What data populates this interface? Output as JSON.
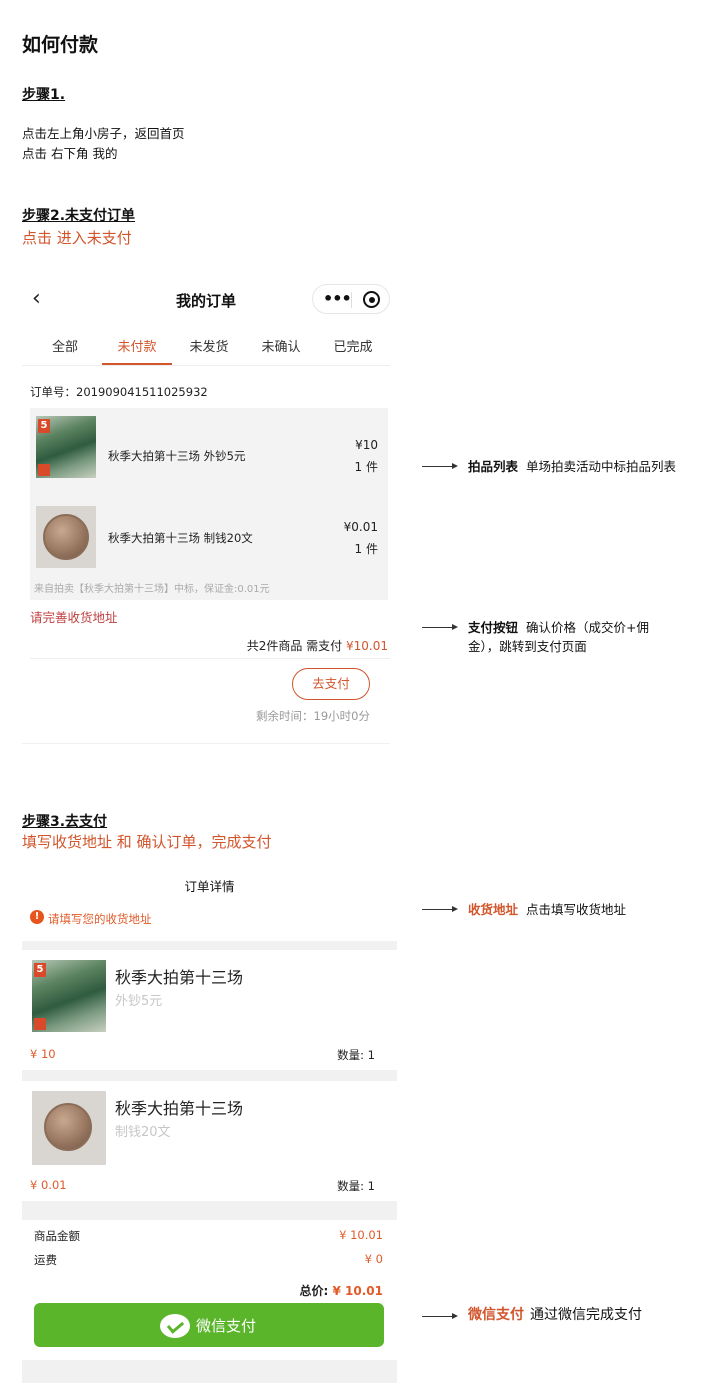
{
  "guide": {
    "title": "如何付款",
    "step1": {
      "title": "步骤1.",
      "line1": "点击左上角小房子，返回首页",
      "line2": "点击 右下角 我的"
    },
    "step2": {
      "title": "步骤2.未支付订单",
      "subtitle": "点击 进入未支付"
    },
    "step3": {
      "title": "步骤3.去支付",
      "subtitle": "填写收货地址  和  确认订单，完成支付"
    }
  },
  "order_list_screen": {
    "nav_title": "我的订单",
    "back_icon": "chevron-left-icon",
    "tabs": [
      "全部",
      "未付款",
      "未发货",
      "未确认",
      "已完成"
    ],
    "active_tab": "未付款",
    "order_no": "订单号：201909041511025932",
    "items": [
      {
        "name": "秋季大拍第十三场 外钞5元",
        "price": "¥10",
        "qty": "1 件",
        "thumb": "stamp-image"
      },
      {
        "name": "秋季大拍第十三场 制钱20文",
        "price": "¥0.01",
        "qty": "1 件",
        "thumb": "coin-image"
      }
    ],
    "items_note": "来自拍卖【秋季大拍第十三场】中标，保证金:0.01元",
    "address_warning": "请完善收货地址",
    "total_prefix": "共2件商品 需支付 ",
    "total_amount": "¥10.01",
    "pay_button": "去支付",
    "remaining_time": "剩余时间：19小时0分"
  },
  "annotations": [
    {
      "title": "拍品列表",
      "text": "单场拍卖活动中标拍品列表"
    },
    {
      "title": "支付按钮",
      "text": "确认价格（成交价+佣",
      "text2": "金），跳转到支付页面"
    },
    {
      "title": "收货地址",
      "text": "点击填写收货地址"
    },
    {
      "title": "微信支付",
      "text": "通过微信完成支付"
    }
  ],
  "order_detail_screen": {
    "title": "订单详情",
    "address_warning": "请填写您的收货地址",
    "cards": [
      {
        "name": "秋季大拍第十三场",
        "sub": "外钞5元",
        "price": "¥ 10",
        "qty": "数量: 1"
      },
      {
        "name": "秋季大拍第十三场",
        "sub": "制钱20文",
        "price": "¥ 0.01",
        "qty": "数量: 1"
      }
    ],
    "goods_amount_label": "商品金额",
    "goods_amount": "¥ 10.01",
    "shipping_label": "运费",
    "shipping": "¥ 0",
    "total_label": "总价: ",
    "total": "¥ 10.01",
    "wechat_pay_button": "微信支付"
  },
  "colors": {
    "accent": "#d2552c",
    "wechat_green": "#5ab52a"
  }
}
